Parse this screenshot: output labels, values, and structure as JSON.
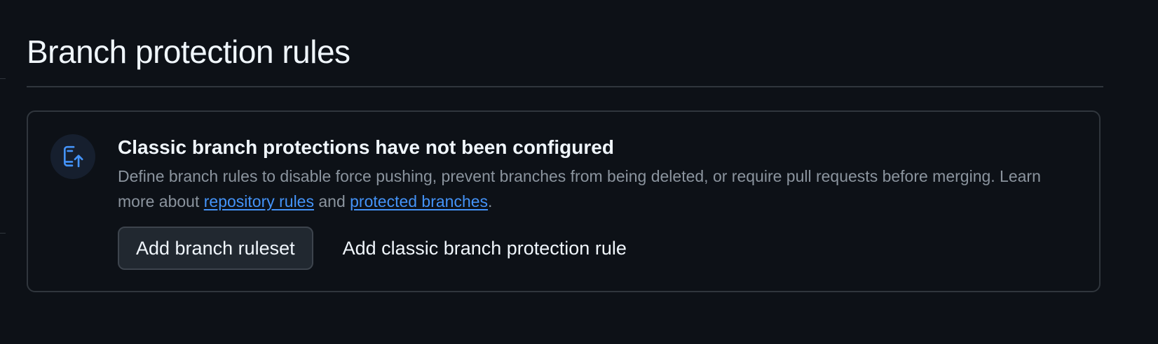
{
  "page": {
    "title": "Branch protection rules"
  },
  "blankslate": {
    "icon": "repo-push-icon",
    "heading": "Classic branch protections have not been configured",
    "description_text": "Define branch rules to disable force pushing, prevent branches from being deleted, or require pull requests before merging. Learn more about ",
    "link_repository_rules": "repository rules",
    "and_text": " and ",
    "link_protected_branches": "protected branches",
    "period": ".",
    "primary_button": "Add branch ruleset",
    "secondary_button": "Add classic branch protection rule"
  },
  "colors": {
    "background": "#0d1117",
    "border": "#30363d",
    "link": "#4493f8",
    "icon_accent": "#4493f8"
  }
}
